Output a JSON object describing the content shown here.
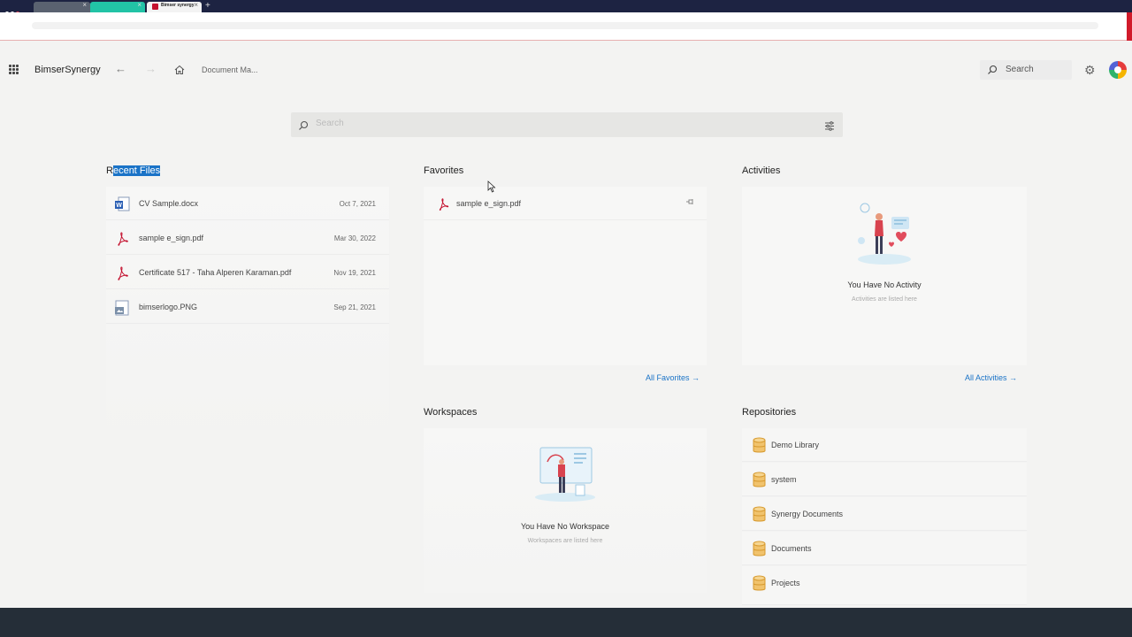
{
  "browser": {
    "tabs": [
      {
        "label": ""
      },
      {
        "label": ""
      },
      {
        "label": "Bimser synergy"
      }
    ],
    "new_tab": "+"
  },
  "header": {
    "brand": "BimserSynergy",
    "breadcrumb": "Document Ma...",
    "search_label": "Search"
  },
  "main_search": {
    "placeholder": "Search"
  },
  "recent_files": {
    "title_first": "R",
    "title_rest": "ecent Files",
    "items": [
      {
        "name": "CV Sample.docx",
        "date": "Oct 7, 2021",
        "icon": "word-doc-icon"
      },
      {
        "name": "sample e_sign.pdf",
        "date": "Mar 30, 2022",
        "icon": "pdf-icon"
      },
      {
        "name": "Certificate 517 - Taha Alperen Karaman.pdf",
        "date": "Nov 19, 2021",
        "icon": "pdf-icon"
      },
      {
        "name": "bimserlogo.PNG",
        "date": "Sep 21, 2021",
        "icon": "image-file-icon"
      }
    ]
  },
  "favorites": {
    "title": "Favorites",
    "items": [
      {
        "name": "sample e_sign.pdf",
        "icon": "pdf-icon"
      }
    ],
    "all_link": "All Favorites"
  },
  "activities": {
    "title": "Activities",
    "empty_title": "You Have No Activity",
    "empty_sub": "Activities are listed here",
    "all_link": "All Activities"
  },
  "workspaces": {
    "title": "Workspaces",
    "empty_title": "You Have No Workspace",
    "empty_sub": "Workspaces are listed here"
  },
  "repositories": {
    "title": "Repositories",
    "items": [
      "Demo Library",
      "system",
      "Synergy Documents",
      "Documents",
      "Projects"
    ]
  },
  "colors": {
    "accent": "#1a73c7",
    "pdf_red": "#c4122f",
    "db_yellow": "#f1c36d",
    "footer": "#252e38"
  }
}
